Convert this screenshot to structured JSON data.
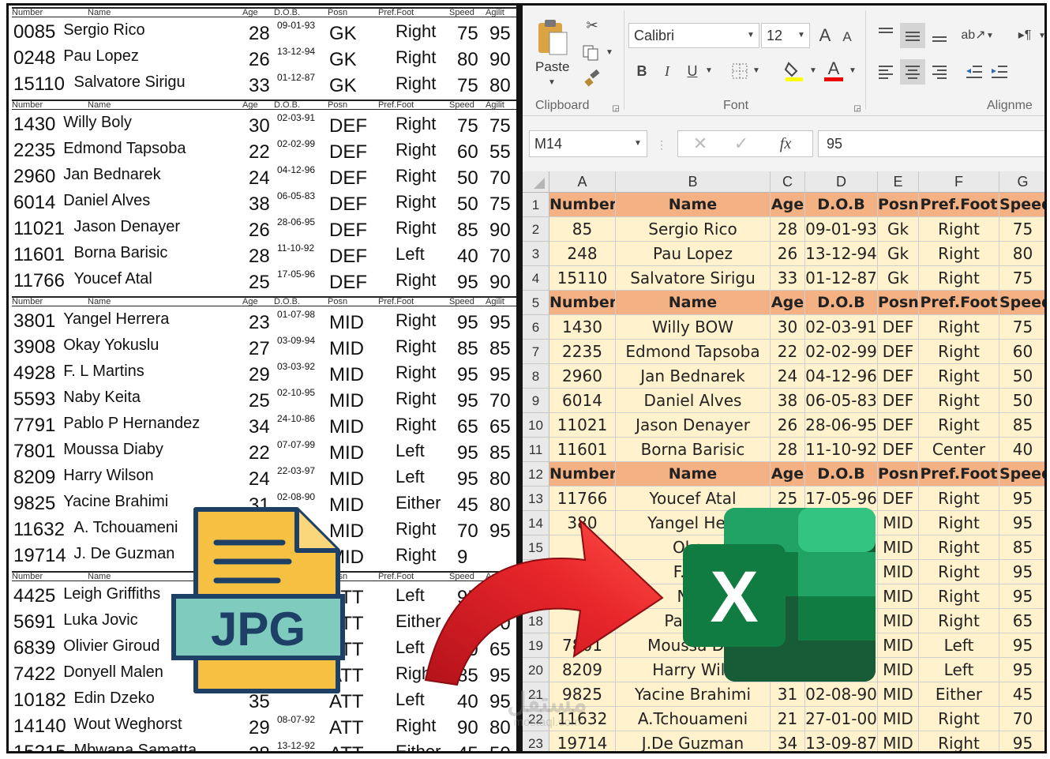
{
  "roster": {
    "header_labels": [
      "Number",
      "Name",
      "Age",
      "D.O.B.",
      "Posn",
      "Pref.Foot",
      "Speed",
      "Agilit"
    ],
    "sections": [
      {
        "players": [
          {
            "num": "0085",
            "name": "Sergio Rico",
            "age": "28",
            "dob": "09-01-93",
            "pos": "GK",
            "foot": "Right",
            "spd": "75",
            "agi": "95"
          },
          {
            "num": "0248",
            "name": "Pau Lopez",
            "age": "26",
            "dob": "13-12-94",
            "pos": "GK",
            "foot": "Right",
            "spd": "80",
            "agi": "90"
          },
          {
            "num": "15110",
            "name": "Salvatore Sirigu",
            "age": "33",
            "dob": "01-12-87",
            "pos": "GK",
            "foot": "Right",
            "spd": "75",
            "agi": "80"
          }
        ]
      },
      {
        "players": [
          {
            "num": "1430",
            "name": "Willy Boly",
            "age": "30",
            "dob": "02-03-91",
            "pos": "DEF",
            "foot": "Right",
            "spd": "75",
            "agi": "75"
          },
          {
            "num": "2235",
            "name": "Edmond Tapsoba",
            "age": "22",
            "dob": "02-02-99",
            "pos": "DEF",
            "foot": "Right",
            "spd": "60",
            "agi": "55"
          },
          {
            "num": "2960",
            "name": "Jan Bednarek",
            "age": "24",
            "dob": "04-12-96",
            "pos": "DEF",
            "foot": "Right",
            "spd": "50",
            "agi": "70"
          },
          {
            "num": "6014",
            "name": "Daniel Alves",
            "age": "38",
            "dob": "06-05-83",
            "pos": "DEF",
            "foot": "Right",
            "spd": "50",
            "agi": "75"
          },
          {
            "num": "11021",
            "name": "Jason Denayer",
            "age": "26",
            "dob": "28-06-95",
            "pos": "DEF",
            "foot": "Right",
            "spd": "85",
            "agi": "90"
          },
          {
            "num": "11601",
            "name": "Borna Barisic",
            "age": "28",
            "dob": "11-10-92",
            "pos": "DEF",
            "foot": "Left",
            "spd": "40",
            "agi": "70"
          },
          {
            "num": "11766",
            "name": "Youcef Atal",
            "age": "25",
            "dob": "17-05-96",
            "pos": "DEF",
            "foot": "Right",
            "spd": "95",
            "agi": "90"
          }
        ]
      },
      {
        "players": [
          {
            "num": "3801",
            "name": "Yangel Herrera",
            "age": "23",
            "dob": "01-07-98",
            "pos": "MID",
            "foot": "Right",
            "spd": "95",
            "agi": "95"
          },
          {
            "num": "3908",
            "name": "Okay Yokuslu",
            "age": "27",
            "dob": "03-09-94",
            "pos": "MID",
            "foot": "Right",
            "spd": "85",
            "agi": "85"
          },
          {
            "num": "4928",
            "name": "F. L Martins",
            "age": "29",
            "dob": "03-03-92",
            "pos": "MID",
            "foot": "Right",
            "spd": "95",
            "agi": "95"
          },
          {
            "num": "5593",
            "name": "Naby Keita",
            "age": "25",
            "dob": "02-10-95",
            "pos": "MID",
            "foot": "Right",
            "spd": "95",
            "agi": "70"
          },
          {
            "num": "7791",
            "name": "Pablo P Hernandez",
            "age": "34",
            "dob": "24-10-86",
            "pos": "MID",
            "foot": "Right",
            "spd": "65",
            "agi": "65"
          },
          {
            "num": "7801",
            "name": "Moussa Diaby",
            "age": "22",
            "dob": "07-07-99",
            "pos": "MID",
            "foot": "Left",
            "spd": "95",
            "agi": "85"
          },
          {
            "num": "8209",
            "name": "Harry Wilson",
            "age": "24",
            "dob": "22-03-97",
            "pos": "MID",
            "foot": "Left",
            "spd": "95",
            "agi": "80"
          },
          {
            "num": "9825",
            "name": "Yacine Brahimi",
            "age": "31",
            "dob": "02-08-90",
            "pos": "MID",
            "foot": "Either",
            "spd": "45",
            "agi": "80"
          },
          {
            "num": "11632",
            "name": "A. Tchouameni",
            "age": "",
            "dob": "00",
            "pos": "MID",
            "foot": "Right",
            "spd": "70",
            "agi": "95"
          },
          {
            "num": "19714",
            "name": "J. De Guzman",
            "age": "",
            "dob": "",
            "pos": "MID",
            "foot": "Right",
            "spd": "9",
            "agi": ""
          }
        ]
      },
      {
        "players": [
          {
            "num": "4425",
            "name": "Leigh Griffiths",
            "age": "",
            "dob": "",
            "pos": "ATT",
            "foot": "Left",
            "spd": "95",
            "agi": "45"
          },
          {
            "num": "5691",
            "name": "Luka Jovic",
            "age": "",
            "dob": "",
            "pos": "ATT",
            "foot": "Either",
            "spd": "95",
            "agi": "70"
          },
          {
            "num": "6839",
            "name": "Olivier Giroud",
            "age": "",
            "dob": "",
            "pos": "ATT",
            "foot": "Left",
            "spd": "60",
            "agi": "65"
          },
          {
            "num": "7422",
            "name": "Donyell Malen",
            "age": "",
            "dob": "",
            "pos": "ATT",
            "foot": "Right",
            "spd": "85",
            "agi": "95"
          },
          {
            "num": "10182",
            "name": "Edin Dzeko",
            "age": "35",
            "dob": "",
            "pos": "ATT",
            "foot": "Left",
            "spd": "40",
            "agi": "95"
          },
          {
            "num": "14140",
            "name": "Wout Weghorst",
            "age": "29",
            "dob": "08-07-92",
            "pos": "ATT",
            "foot": "Right",
            "spd": "90",
            "agi": "80"
          },
          {
            "num": "15215",
            "name": "Mbwana Samatta",
            "age": "28",
            "dob": "13-12-92",
            "pos": "ATT",
            "foot": "Either",
            "spd": "45",
            "agi": "50"
          }
        ]
      }
    ]
  },
  "ribbon": {
    "paste_label": "Paste",
    "font_name": "Calibri",
    "font_size": "12",
    "bold": "B",
    "italic": "I",
    "underline": "U",
    "grow_font": "A",
    "shrink_font": "A",
    "font_color_letter": "A",
    "group_clipboard": "Clipboard",
    "group_font": "Font",
    "group_alignment": "Alignme"
  },
  "formula_bar": {
    "name_box": "M14",
    "fx": "fx",
    "value": "95"
  },
  "sheet": {
    "columns": [
      "A",
      "B",
      "C",
      "D",
      "E",
      "F",
      "G"
    ],
    "rows": [
      {
        "n": "1",
        "type": "hdr",
        "cells": [
          "Number",
          "Name",
          "Age",
          "D.O.B",
          "Posn",
          "Pref.Foot",
          "Speed"
        ]
      },
      {
        "n": "2",
        "type": "dat",
        "cells": [
          "85",
          "Sergio Rico",
          "28",
          "09-01-93",
          "Gk",
          "Right",
          "75"
        ]
      },
      {
        "n": "3",
        "type": "dat",
        "cells": [
          "248",
          "Pau Lopez",
          "26",
          "13-12-94",
          "Gk",
          "Right",
          "80"
        ]
      },
      {
        "n": "4",
        "type": "dat",
        "cells": [
          "15110",
          "Salvatore Sirigu",
          "33",
          "01-12-87",
          "Gk",
          "Right",
          "75"
        ]
      },
      {
        "n": "5",
        "type": "hdr",
        "cells": [
          "Number",
          "Name",
          "Age",
          "D.O.B",
          "Posn",
          "Pref.Foot",
          "Speed"
        ]
      },
      {
        "n": "6",
        "type": "dat",
        "cells": [
          "1430",
          "Willy BOW",
          "30",
          "02-03-91",
          "DEF",
          "Right",
          "75"
        ]
      },
      {
        "n": "7",
        "type": "dat",
        "cells": [
          "2235",
          "Edmond Tapsoba",
          "22",
          "02-02-99",
          "DEF",
          "Right",
          "60"
        ]
      },
      {
        "n": "8",
        "type": "dat",
        "cells": [
          "2960",
          "Jan Bednarek",
          "24",
          "04-12-96",
          "DEF",
          "Right",
          "50"
        ]
      },
      {
        "n": "9",
        "type": "dat",
        "cells": [
          "6014",
          "Daniel Alves",
          "38",
          "06-05-83",
          "DEF",
          "Right",
          "50"
        ]
      },
      {
        "n": "10",
        "type": "dat",
        "cells": [
          "11021",
          "Jason Denayer",
          "26",
          "28-06-95",
          "DEF",
          "Right",
          "85"
        ]
      },
      {
        "n": "11",
        "type": "dat",
        "cells": [
          "11601",
          "Borna Barisic",
          "28",
          "11-10-92",
          "DEF",
          "Center",
          "40"
        ]
      },
      {
        "n": "12",
        "type": "hdr",
        "cells": [
          "Number",
          "Name",
          "Age",
          "D.O.B",
          "Posn",
          "Pref.Foot",
          "Speed"
        ]
      },
      {
        "n": "13",
        "type": "dat",
        "cells": [
          "11766",
          "Youcef Atal",
          "25",
          "17-05-96",
          "DEF",
          "Right",
          "95"
        ]
      },
      {
        "n": "14",
        "type": "dat",
        "cells": [
          "380",
          "Yangel Herr",
          "",
          "",
          "MID",
          "Right",
          "95"
        ]
      },
      {
        "n": "15",
        "type": "dat",
        "cells": [
          "",
          "Okay",
          "",
          "",
          "MID",
          "Right",
          "85"
        ]
      },
      {
        "n": "16",
        "type": "dat",
        "cells": [
          "",
          "F.L M",
          "",
          "",
          "MID",
          "Right",
          "95"
        ]
      },
      {
        "n": "17",
        "type": "dat",
        "cells": [
          "",
          "Nab",
          "",
          "",
          "MID",
          "Right",
          "95"
        ]
      },
      {
        "n": "18",
        "type": "dat",
        "cells": [
          "",
          "Pablo P",
          "",
          "",
          "MID",
          "Right",
          "65"
        ]
      },
      {
        "n": "19",
        "type": "dat",
        "cells": [
          "7801",
          "Moussa Dia",
          "",
          "",
          "MID",
          "Left",
          "95"
        ]
      },
      {
        "n": "20",
        "type": "dat",
        "cells": [
          "8209",
          "Harry Wils",
          "",
          "",
          "MID",
          "Left",
          "95"
        ]
      },
      {
        "n": "21",
        "type": "dat",
        "cells": [
          "9825",
          "Yacine Brahimi",
          "31",
          "02-08-90",
          "MID",
          "Either",
          "45"
        ]
      },
      {
        "n": "22",
        "type": "dat",
        "cells": [
          "11632",
          "A.Tchouameni",
          "21",
          "27-01-00",
          "MID",
          "Right",
          "70"
        ]
      },
      {
        "n": "23",
        "type": "dat",
        "cells": [
          "19714",
          "J.De Guzman",
          "34",
          "13-09-87",
          "MID",
          "Right",
          "95"
        ]
      }
    ]
  },
  "overlay": {
    "jpg_label": "JPG",
    "excel_letter": "X",
    "watermark": "مستقل",
    "watermark_sub": "mostaql.com"
  },
  "colors": {
    "header_fill": "#f4b183",
    "data_fill": "#fff2cc",
    "jpg_body": "#f6c042",
    "jpg_band": "#7fcbbd",
    "jpg_text": "#1e3f66",
    "arrow_red": "#e8262b",
    "excel_green_dark": "#185c37",
    "excel_green": "#21a366",
    "excel_green_light": "#33c481",
    "excel_tile": "#107c41"
  }
}
